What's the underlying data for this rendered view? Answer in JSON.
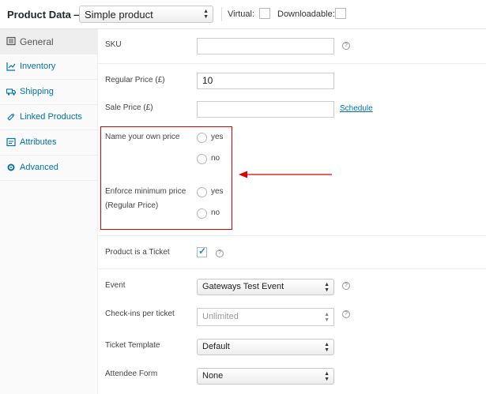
{
  "header": {
    "title": "Product Data —",
    "product_type": "Simple product",
    "virtual_label": "Virtual:",
    "downloadable_label": "Downloadable:",
    "virtual_checked": false,
    "downloadable_checked": false
  },
  "sidebar": {
    "items": [
      {
        "label": "General",
        "icon": "general-icon",
        "active": true
      },
      {
        "label": "Inventory",
        "icon": "inventory-icon",
        "active": false
      },
      {
        "label": "Shipping",
        "icon": "truck-icon",
        "active": false
      },
      {
        "label": "Linked Products",
        "icon": "link-icon",
        "active": false
      },
      {
        "label": "Attributes",
        "icon": "attributes-icon",
        "active": false
      },
      {
        "label": "Advanced",
        "icon": "gear-icon",
        "active": false
      }
    ]
  },
  "general": {
    "sku_label": "SKU",
    "sku_value": "",
    "regular_price_label": "Regular Price (£)",
    "regular_price_value": "10",
    "sale_price_label": "Sale Price (£)",
    "sale_price_value": "",
    "schedule_link": "Schedule",
    "nyop_label": "Name your own price",
    "nyop_yes": "yes",
    "nyop_no": "no",
    "enforce_label_line1": "Enforce minimum price",
    "enforce_label_line2": "(Regular Price)",
    "enforce_yes": "yes",
    "enforce_no": "no",
    "ticket_label": "Product is a Ticket",
    "ticket_checked": true,
    "event_label": "Event",
    "event_value": "Gateways Test Event",
    "checkins_label": "Check-ins per ticket",
    "checkins_placeholder": "Unlimited",
    "template_label": "Ticket Template",
    "template_value": "Default",
    "attendee_label": "Attendee Form",
    "attendee_value": "None",
    "help_glyph": "?"
  },
  "colors": {
    "highlight": "#dd0000",
    "link": "#0073aa"
  }
}
